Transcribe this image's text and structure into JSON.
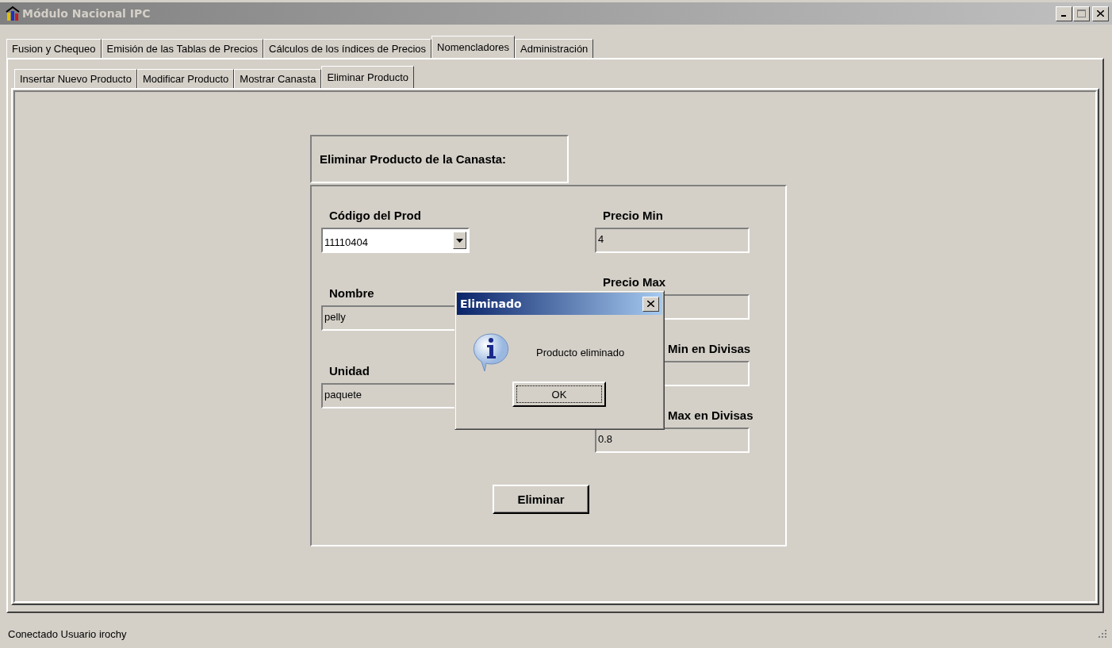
{
  "window": {
    "title": "Módulo Nacional IPC"
  },
  "tabs": [
    {
      "label": "Fusion y Chequeo",
      "selected": false
    },
    {
      "label": "Emisión de las Tablas de Precios",
      "selected": false
    },
    {
      "label": "Cálculos de los índices de Precios",
      "selected": false
    },
    {
      "label": "Nomencladores",
      "selected": true
    },
    {
      "label": "Administración",
      "selected": false
    }
  ],
  "subtabs": [
    {
      "label": "Insertar Nuevo Producto",
      "selected": false
    },
    {
      "label": "Modificar Producto",
      "selected": false
    },
    {
      "label": "Mostrar Canasta",
      "selected": false
    },
    {
      "label": "Eliminar Producto",
      "selected": true
    }
  ],
  "form": {
    "heading": "Eliminar Producto de la Canasta:",
    "left_fields": [
      {
        "kind": "combo",
        "label": "Código del Prod",
        "value": "11110404"
      },
      {
        "kind": "text",
        "label": "Nombre",
        "value": "pelly"
      },
      {
        "kind": "text",
        "label": "Unidad",
        "value": "paquete"
      }
    ],
    "right_fields": [
      {
        "kind": "text",
        "label": "Precio Min",
        "value": "4"
      },
      {
        "kind": "text",
        "label": "Precio Max"
      },
      {
        "kind": "text",
        "label": "Min en Divisas",
        "partial": true
      },
      {
        "kind": "text",
        "label": "Max en Divisas",
        "value": "0.8",
        "partial": true
      }
    ],
    "button": "Eliminar"
  },
  "dialog": {
    "title": "Eliminado",
    "message": "Producto eliminado",
    "button": "OK"
  },
  "status_bar": {
    "text": "Conectado  Usuario  irochy"
  }
}
